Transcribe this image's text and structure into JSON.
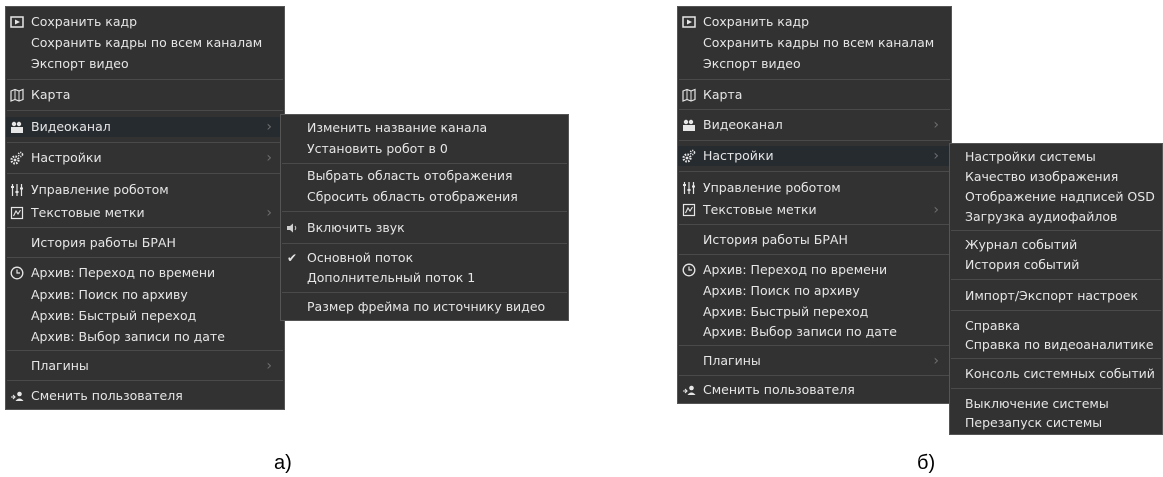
{
  "main_items": {
    "save_frame": "Сохранить кадр",
    "save_frames_all": "Сохранить кадры по всем каналам",
    "export_video": "Экспорт видео",
    "map": "Карта",
    "video_channel": "Видеоканал",
    "settings": "Настройки",
    "robot_control": "Управление роботом",
    "text_labels": "Текстовые метки",
    "bran_history": "История работы БРАН",
    "archive_time": "Архив: Переход по времени",
    "archive_search": "Архив: Поиск по архиву",
    "archive_quick": "Архив: Быстрый переход",
    "archive_date": "Архив: Выбор записи по дате",
    "plugins": "Плагины",
    "switch_user": "Сменить пользователя"
  },
  "channel_submenu": {
    "rename": "Изменить название канала",
    "robot_zero": "Установить робот в 0",
    "select_area": "Выбрать область отображения",
    "reset_area": "Сбросить область отображения",
    "sound_on": "Включить звук",
    "main_stream": "Основной поток",
    "extra_stream": "Дополнительный поток 1",
    "frame_size": "Размер фрейма по источнику видео"
  },
  "settings_submenu": {
    "system_settings": "Настройки системы",
    "image_quality": "Качество изображения",
    "osd_display": "Отображение надписей OSD",
    "audio_upload": "Загрузка аудиофайлов",
    "event_log": "Журнал событий",
    "event_history": "История событий",
    "import_export": "Импорт/Экспорт настроек",
    "help": "Справка",
    "video_analytics_help": "Справка по видеоаналитике",
    "event_console": "Консоль системных событий",
    "shutdown": "Выключение системы",
    "restart": "Перезапуск системы"
  },
  "captions": {
    "a": "а)",
    "b": "б)"
  },
  "icons": [
    "save-frame-icon",
    "map-icon",
    "video-camera-icon",
    "gears-icon",
    "sliders-icon",
    "text-label-icon",
    "clock-icon",
    "switch-user-icon",
    "speaker-icon",
    "checkmark-icon",
    "chevron-right-icon"
  ],
  "colors": {
    "menu_bg": "#323232",
    "menu_border": "#555555",
    "highlight": "#262b2f",
    "text": "#e6e6e6",
    "arrow": "#6e6e6e"
  }
}
